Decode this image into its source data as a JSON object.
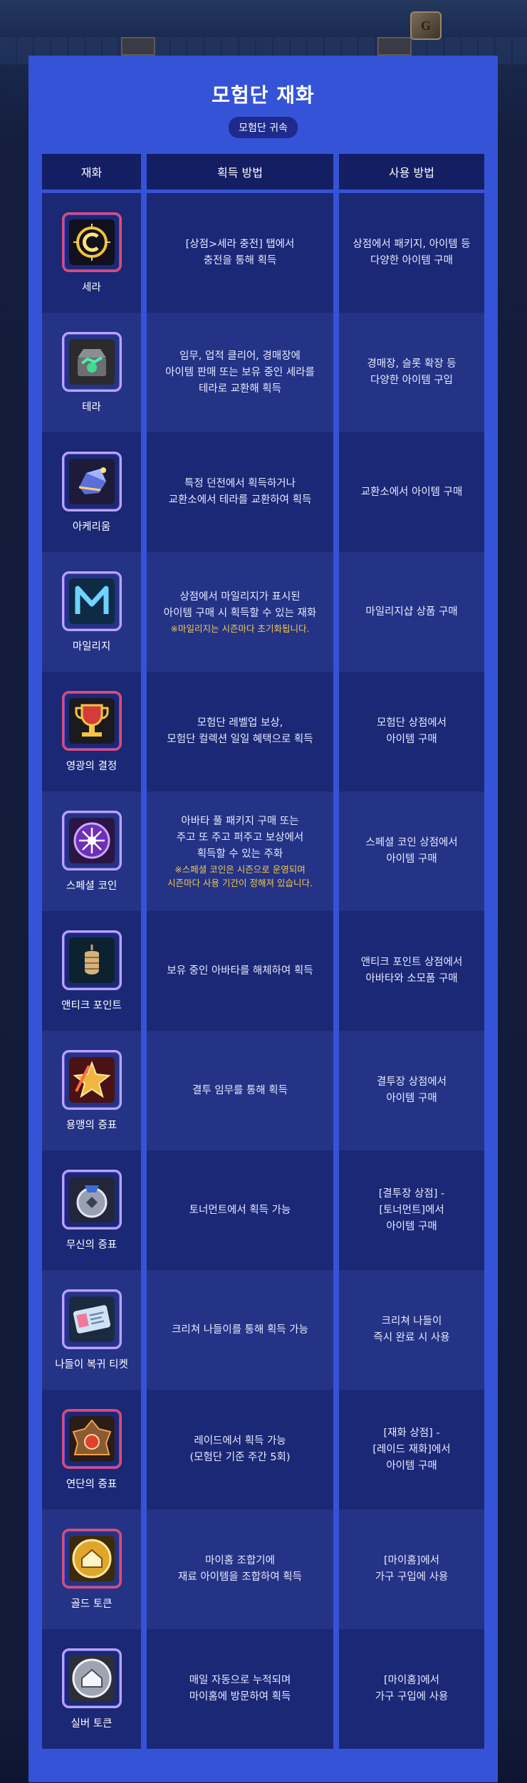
{
  "header": {
    "title": "모험단 재화",
    "subtitle": "모험단 귀속"
  },
  "table": {
    "columns": [
      "재화",
      "획득 방법",
      "사용 방법"
    ],
    "rows": [
      {
        "name": "세라",
        "icon": "sera-coin-icon",
        "acquire": "[상점>세라 충전] 탭에서\n충전을 통해 획득",
        "note": "",
        "usage": "상점에서 패키지, 아이템 등\n다양한 아이템 구매"
      },
      {
        "name": "테라",
        "icon": "tera-chest-icon",
        "acquire": "임무, 업적 클리어, 경매장에\n아이템 판매 또는 보유 중인 세라를\n테라로 교환해 획득",
        "note": "",
        "usage": "경매장, 슬롯 확장 등\n다양한 아이템 구입"
      },
      {
        "name": "아케리움",
        "icon": "akerium-crystal-icon",
        "acquire": "특정 던전에서 획득하거나\n교환소에서 테라를 교환하여 획득",
        "note": "",
        "usage": "교환소에서 아이템 구매"
      },
      {
        "name": "마일리지",
        "icon": "mileage-m-icon",
        "acquire": "상점에서 마일리지가 표시된\n아이템 구매 시 획득할 수 있는 재화",
        "note": "※마일리지는 시즌마다 초기화됩니다.",
        "usage": "마일리지샵 상품 구매"
      },
      {
        "name": "영광의 결정",
        "icon": "glory-trophy-icon",
        "acquire": "모험단 레벨업 보상,\n모험단 컬렉션 일일 혜택으로 획득",
        "note": "",
        "usage": "모험단 상점에서\n아이템 구매"
      },
      {
        "name": "스페셜 코인",
        "icon": "special-coin-icon",
        "acquire": "아바타 풀 패키지 구매 또는\n주고 또 주고 퍼주고 보상에서\n획득할 수 있는 주화",
        "note": "※스페셜 코인은 시즌으로 운영되며\n시즌마다 사용 기간이 정해져 있습니다.",
        "usage": "스페셜 코인 상점에서\n아이템 구매"
      },
      {
        "name": "앤티크 포인트",
        "icon": "antique-point-icon",
        "acquire": "보유 중인 아바타를 해체하여 획득",
        "note": "",
        "usage": "앤티크 포인트 상점에서\n아바타와 소모품 구매"
      },
      {
        "name": "용맹의 증표",
        "icon": "valor-token-icon",
        "acquire": "결투 임무를 통해 획득",
        "note": "",
        "usage": "결투장 상점에서\n아이템 구매"
      },
      {
        "name": "무신의 증표",
        "icon": "war-god-token-icon",
        "acquire": "토너먼트에서 획득 가능",
        "note": "",
        "usage": "[결투장 상점] -\n[토너먼트]에서\n아이템 구매"
      },
      {
        "name": "나들이 복귀 티켓",
        "icon": "outing-ticket-icon",
        "acquire": "크리쳐 나들이를 통해 획득 가능",
        "note": "",
        "usage": "크리쳐 나들이\n즉시 완료 시 사용"
      },
      {
        "name": "연단의 증표",
        "icon": "forging-token-icon",
        "acquire": "레이드에서 획득 가능\n(모험단 기준 주간 5회)",
        "note": "",
        "usage": "[재화 상점] -\n[레이드 재화]에서\n아이템 구매"
      },
      {
        "name": "골드 토큰",
        "icon": "gold-home-token-icon",
        "acquire": "마이홈 조합기에\n재료 아이템을 조합하여 획득",
        "note": "",
        "usage": "[마이홈]에서\n가구 구입에 사용"
      },
      {
        "name": "실버 토큰",
        "icon": "silver-home-token-icon",
        "acquire": "매일 자동으로 누적되며\n마이홈에 방문하여 획득",
        "note": "",
        "usage": "[마이홈]에서\n가구 구입에 사용"
      }
    ]
  },
  "colors": {
    "panel": "#3553d6",
    "header_cell": "#141e63",
    "row_odd": "#1b2876",
    "row_even": "#243386",
    "note": "#f3c94c",
    "badge": "#1e2a8c"
  }
}
